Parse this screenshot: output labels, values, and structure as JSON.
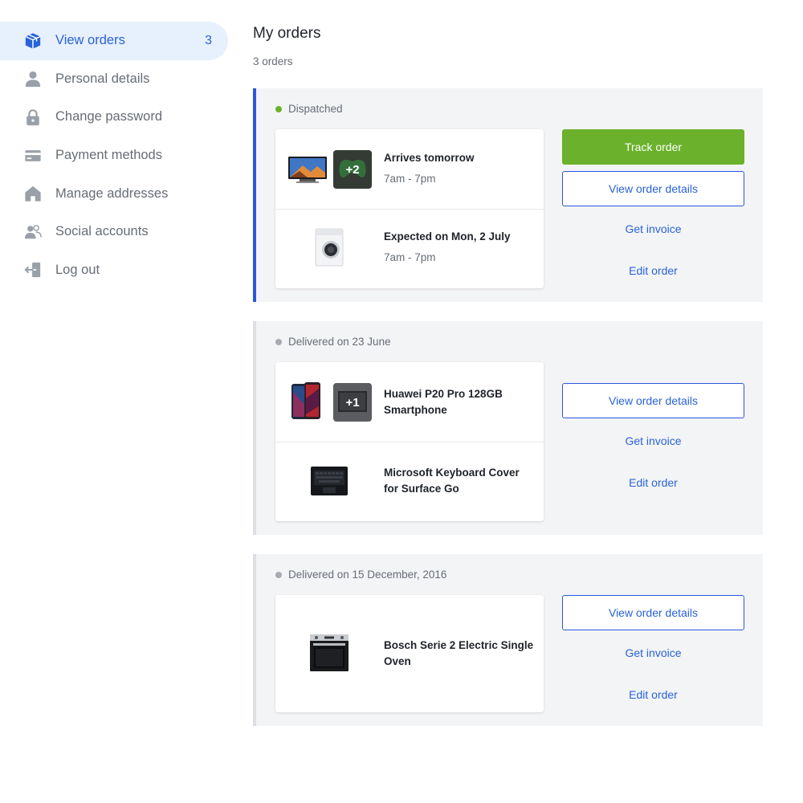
{
  "sidebar": {
    "items": [
      {
        "label": "View orders",
        "icon": "box-icon",
        "count": "3",
        "active": true
      },
      {
        "label": "Personal details",
        "icon": "person-icon"
      },
      {
        "label": "Change password",
        "icon": "lock-icon"
      },
      {
        "label": "Payment methods",
        "icon": "credit-card-icon"
      },
      {
        "label": "Manage addresses",
        "icon": "home-icon"
      },
      {
        "label": "Social accounts",
        "icon": "people-icon"
      },
      {
        "label": "Log out",
        "icon": "logout-icon"
      }
    ]
  },
  "main": {
    "title": "My orders",
    "count_text": "3 orders"
  },
  "orders": [
    {
      "status": "Dispatched",
      "status_color": "#6bb12b",
      "items": [
        {
          "title": "Arrives tomorrow",
          "subtitle": "7am - 7pm",
          "plus_badge": "+2"
        },
        {
          "title": "Expected on Mon, 2 July",
          "subtitle": "7am - 7pm"
        }
      ],
      "track_label": "Track order",
      "details_label": "View order details",
      "invoice_label": "Get invoice",
      "edit_label": "Edit order"
    },
    {
      "status": "Delivered on 23 June",
      "status_color": "#a7abb1",
      "items": [
        {
          "title": "Huawei P20 Pro 128GB Smartphone",
          "plus_badge": "+1"
        },
        {
          "title": "Microsoft Keyboard Cover for Surface Go"
        }
      ],
      "details_label": "View order details",
      "invoice_label": "Get invoice",
      "edit_label": "Edit order"
    },
    {
      "status": "Delivered on 15 December, 2016",
      "status_color": "#a7abb1",
      "items": [
        {
          "title": "Bosch Serie 2 Electric Single Oven"
        }
      ],
      "details_label": "View order details",
      "invoice_label": "Get invoice",
      "edit_label": "Edit order"
    }
  ],
  "colors": {
    "accent": "#2962d9",
    "active_nav_bg": "#e7f0fd",
    "success": "#6bb12b",
    "panel_bg": "#f3f4f6",
    "active_border": "#2b58d8",
    "muted_text": "#676d75"
  }
}
